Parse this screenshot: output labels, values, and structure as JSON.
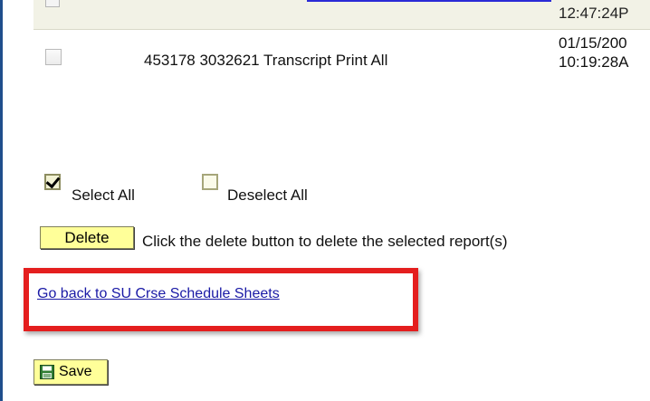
{
  "prev_row": {
    "time_partial": "12:47:24P"
  },
  "report_row": {
    "description": "453178 3032621 Transcript Print All",
    "date": "01/15/200",
    "time": "10:19:28A"
  },
  "selection": {
    "select_all_label": "Select All",
    "deselect_all_label": "Deselect All"
  },
  "delete": {
    "button_label": "Delete",
    "hint": "Click the delete button to delete the selected report(s)"
  },
  "back_link": {
    "label": "Go back to SU Crse Schedule Sheets"
  },
  "save": {
    "button_label": "Save"
  },
  "colors": {
    "highlight": "#e41e1e",
    "button_bg": "#ffff99",
    "link": "#1a1aa6",
    "row_bg": "#f2f2e6"
  }
}
